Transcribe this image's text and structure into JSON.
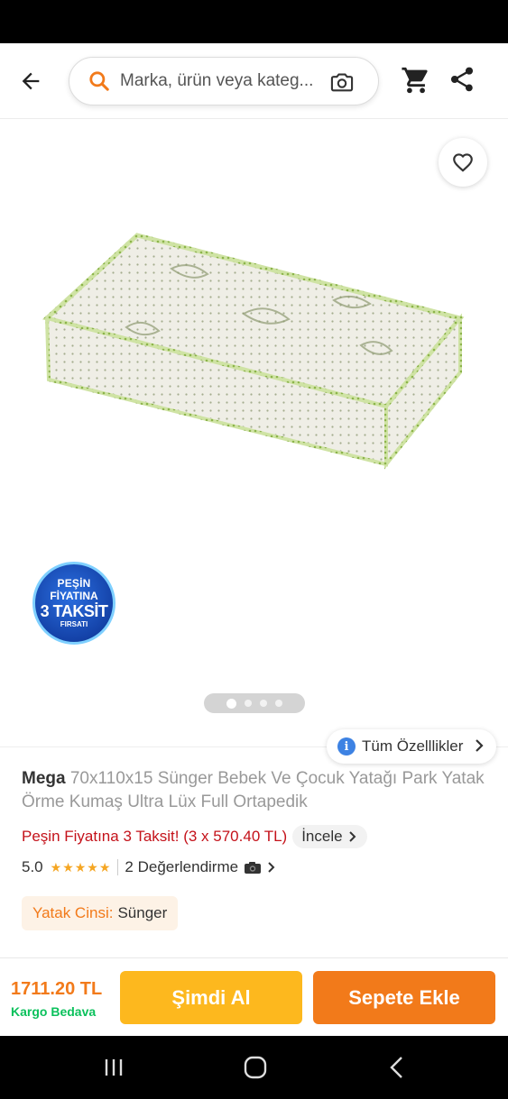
{
  "header": {
    "search_placeholder": "Marka, ürün veya kateg...",
    "icons": [
      "back-arrow-icon",
      "search-icon",
      "camera-icon",
      "cart-icon",
      "share-icon"
    ]
  },
  "gallery": {
    "promo_badge": {
      "line1": "PEŞİN",
      "line2": "FİYATINA",
      "line3": "3 TAKSİT",
      "line4": "FIRSATI"
    },
    "page_count": 4,
    "active_page": 1
  },
  "specs_button": {
    "label": "Tüm Özelllikler"
  },
  "product": {
    "brand": "Mega",
    "name": "70x110x15 Sünger Bebek Ve Çocuk Yatağı Park Yatak Örme Kumaş Ultra Lüx Full Ortapedik",
    "installment_text": "Peşin Fiyatına 3 Taksit! (3 x 570.40 TL)",
    "installment_link": "İncele",
    "rating_value": "5.0",
    "stars": "★★★★★",
    "rating_count_label": "2 Değerlendirme",
    "attribute": {
      "key": "Yatak Cinsi:",
      "value": "Sünger"
    }
  },
  "bottom_bar": {
    "price": "1711.20 TL",
    "shipping": "Kargo Bedava",
    "buy_now_label": "Şimdi Al",
    "add_to_cart_label": "Sepete Ekle"
  },
  "colors": {
    "brand_orange": "#f27a1a",
    "buy_yellow": "#fdb81e",
    "installment_red": "#c4121a",
    "shipping_green": "#0bc15c",
    "star_gold": "#f5a623"
  }
}
